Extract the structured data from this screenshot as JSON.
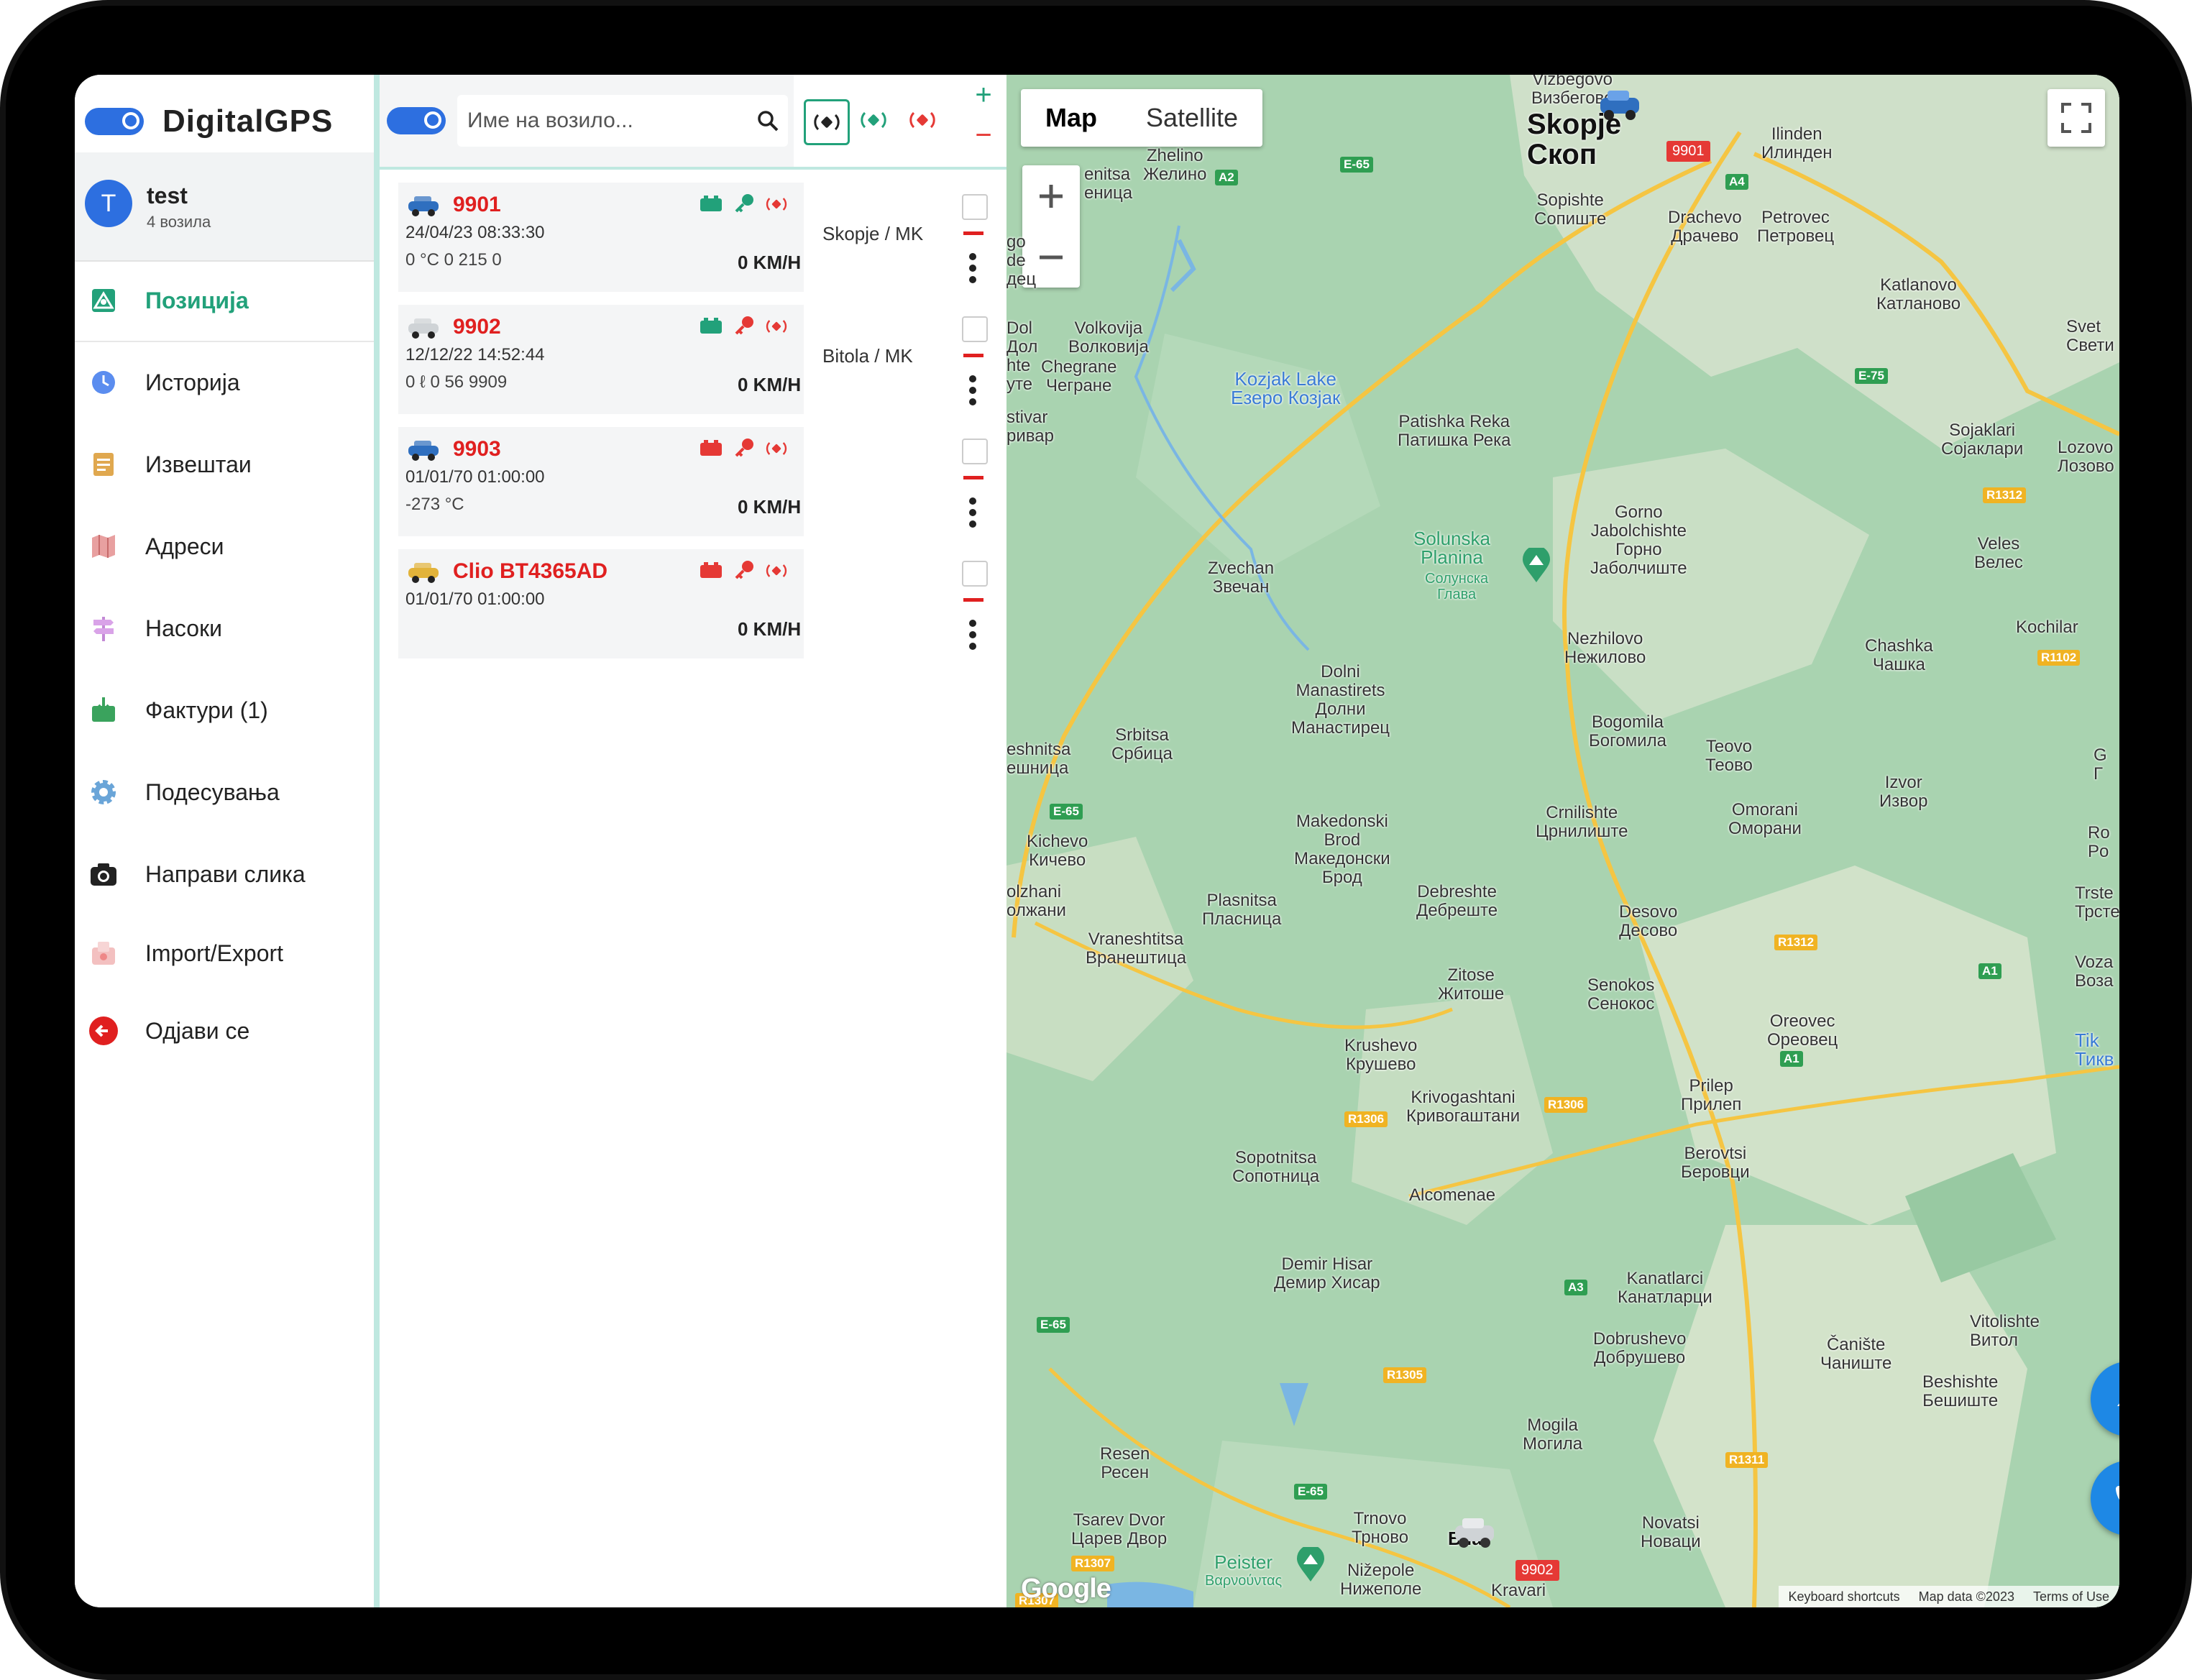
{
  "app": {
    "brand": "DigitalGPS"
  },
  "account": {
    "initial": "T",
    "name": "test",
    "subtitle": "4 возила"
  },
  "nav": [
    {
      "label": "Позиција",
      "icon": "map-position-icon",
      "active": true
    },
    {
      "label": "Историја",
      "icon": "history-clock-icon"
    },
    {
      "label": "Извештаи",
      "icon": "reports-icon"
    },
    {
      "label": "Адреси",
      "icon": "folded-map-icon"
    },
    {
      "label": "Насоки",
      "icon": "signpost-icon"
    },
    {
      "label": "Фактури (1)",
      "icon": "invoice-icon"
    },
    {
      "label": "Подесувања",
      "icon": "gear-icon"
    },
    {
      "label": "Направи слика",
      "icon": "camera-icon"
    },
    {
      "label": "Import/Export",
      "icon": "import-export-icon"
    },
    {
      "label": "Одјави се",
      "icon": "logout-icon"
    }
  ],
  "search": {
    "placeholder": "Име на возило..."
  },
  "vehicles": [
    {
      "name": "9901",
      "date": "24/04/23 08:33:30",
      "meta": "0 °C  0  215  0",
      "speed": "0 KM/H",
      "city": "Skopje / MK",
      "battery": "#22a17a",
      "key": "#22a17a",
      "signal": "#e53935"
    },
    {
      "name": "9902",
      "date": "12/12/22 14:52:44",
      "meta": "0 ℓ  0  56  9909",
      "speed": "0 KM/H",
      "city": "Bitola / MK",
      "battery": "#22a17a",
      "key": "#e53935",
      "signal": "#e53935"
    },
    {
      "name": "9903",
      "date": "01/01/70 01:00:00",
      "meta": "-273 °C",
      "speed": "0 KM/H",
      "city": "",
      "battery": "#e53935",
      "key": "#e53935",
      "signal": "#e53935"
    },
    {
      "name": "Clio BT4365AD",
      "date": "01/01/70 01:00:00",
      "meta": "",
      "speed": "0 KM/H",
      "city": "",
      "battery": "#e53935",
      "key": "#e53935",
      "signal": "#e53935"
    }
  ],
  "map": {
    "tab_map": "Map",
    "tab_satellite": "Satellite",
    "places": {
      "skopje": "Skopje",
      "skopje_cyr": "Скоп",
      "vizbegovo": "Vizbegovo",
      "vizbegovo_cyr": "Визбегово",
      "ilinden": "Ilinden",
      "ilinden_cyr": "Илинден",
      "zhelino": "Zhelino",
      "zhelino_cyr": "Желино",
      "sopishte": "Sopishte",
      "sopishte_cyr": "Сопиште",
      "drachevo": "Drachevo",
      "drachevo_cyr": "Драчево",
      "petrovec": "Petrovec",
      "petrovec_cyr": "Петровец",
      "katlanovo": "Katlanovo",
      "katlanovo_cyr": "Катланово",
      "volkovija": "Volkovija",
      "volkovija_cyr": "Волковија",
      "chegrane": "Chegrane",
      "chegrane_cyr": "Чегране",
      "kozjak": "Kozjak Lake",
      "kozjak_cyr": "Езеро Козјак",
      "patishka": "Patishka Reka",
      "patishka_cyr": "Патишка Река",
      "sojaklari": "Sojaklari",
      "sojaklari_cyr": "Сојаклари",
      "gorno": "Gorno",
      "jabolchishte": "Jabolchishte",
      "gorno_cyr": "Горно",
      "jabolchishte_cyr": "Јаболчиште",
      "solunska1": "Solunska",
      "solunska2": "Planina",
      "solunska_cyr1": "Солунска",
      "solunska_cyr2": "Глава",
      "veles": "Veles",
      "veles_cyr": "Велес",
      "zvechan": "Zvechan",
      "zvechan_cyr": "Звечан",
      "nezhilovo": "Nezhilovo",
      "nezhilovo_cyr": "Нежилово",
      "chashka": "Chashka",
      "chashka_cyr": "Чашка",
      "kochilar": "Kochilar",
      "dolni1": "Dolni",
      "dolni2": "Manastirets",
      "dolni_cyr1": "Долни",
      "dolni_cyr2": "Манастирец",
      "bogomila": "Bogomila",
      "bogomila_cyr": "Богомила",
      "teovo": "Teovo",
      "teovo_cyr": "Теово",
      "srbitsa": "Srbitsa",
      "srbitsa_cyr": "Србица",
      "izvor": "Izvor",
      "izvor_cyr": "Извор",
      "crnilishte": "Crnilishte",
      "crnilishte_cyr": "Црнилиште",
      "omorani": "Omorani",
      "omorani_cyr": "Оморани",
      "kichevo": "Kichevo",
      "kichevo_cyr": "Кичево",
      "makedonski1": "Makedonski",
      "makedonski2": "Brod",
      "makedonski_cyr1": "Македонски",
      "makedonski_cyr2": "Брод",
      "plasnitsa": "Plasnitsa",
      "plasnitsa_cyr": "Пласница",
      "debreshte": "Debreshte",
      "debreshte_cyr": "Дебреште",
      "desovo": "Desovo",
      "desovo_cyr": "Десово",
      "vraneshtitsa": "Vraneshtitsa",
      "vraneshtitsa_cyr": "Вранештица",
      "zitose": "Zitose",
      "zitose_cyr": "Житоше",
      "senokos": "Senokos",
      "senokos_cyr": "Сенокос",
      "oreovec": "Oreovec",
      "oreovec_cyr": "Ореовец",
      "krushevo": "Krushevo",
      "krushevo_cyr": "Крушево",
      "prilep": "Prilep",
      "prilep_cyr": "Прилеп",
      "krivogashtani": "Krivogashtani",
      "krivogashtani_cyr": "Кривогаштани",
      "berovtsi": "Berovtsi",
      "berovtsi_cyr": "Беровци",
      "sopotnitsa": "Sopotnitsa",
      "sopotnitsa_cyr": "Сопотница",
      "alcomenae": "Alcomenae",
      "demir": "Demir Hisar",
      "demir_cyr": "Демир Хисар",
      "kanatlarci": "Kanatlarci",
      "kanatlarci_cyr": "Канатларци",
      "dobrushevo": "Dobrushevo",
      "dobrushevo_cyr": "Добрушево",
      "caniste": "Čanište",
      "caniste_cyr": "Чаниште",
      "vitolishte": "Vitolishte",
      "vitolishte_cyr": "Витол",
      "beshishte": "Beshishte",
      "beshishte_cyr": "Бешиште",
      "mogila": "Mogila",
      "mogila_cyr": "Могила",
      "resen": "Resen",
      "resen_cyr": "Ресен",
      "tsarev": "Tsarev Dvor",
      "tsarev_cyr": "Царев Двор",
      "trnovo": "Trnovo",
      "trnovo_cyr": "Трново",
      "bitola_frag": "B   la",
      "bitola_frag2": "a",
      "novatsi": "Novatsi",
      "novatsi_cyr": "Новаци",
      "peister": "Peister",
      "peister_gr": "Βαρνούντας",
      "nizepole": "Nižepole",
      "nizepole_cyr": "Нижеполе",
      "kravari": "Kravari",
      "svet": "Svet",
      "svet_cyr": "Свети",
      "lozovo": "Lozovo",
      "lozovo_cyr": "Лозово",
      "ro": "Ro",
      "po": "Po",
      "trste": "Trste",
      "trste_cyr": "Трсте",
      "voza": "Voza",
      "voza_cyr": "Воза",
      "tik": "Tik",
      "tik_cyr": "Тикв",
      "g": "G",
      "g_cyr": "Г",
      "eshnitsa": "eshnitsa",
      "eshnitsa_cyr": "ешница",
      "olzhani": "olzhani",
      "olzhani_cyr": "олжани",
      "stivar": "stivar",
      "stivar_cyr": "ривар",
      "enitsa": "enitsa",
      "enitsa_cyr": "еница",
      "go": "go",
      "de": "de",
      "dets": "дец",
      "dol": "Dol",
      "dol_cyr": "Дол",
      "hte": "hte",
      "ute": "уте"
    },
    "roads": {
      "a2": "A2",
      "e65": "E-65",
      "a4": "A4",
      "e75": "E-75",
      "r1312": "R1312",
      "r1102": "R1102",
      "r1306": "R1306",
      "r1306b": "R1306",
      "a1": "A1",
      "a1b": "A1",
      "a3": "A3",
      "r1305": "R1305",
      "r1311": "R1311",
      "r1307": "R1307",
      "e65b": "E-65",
      "e65c": "E-65",
      "e65d": "E-65",
      "r1312b": "R1312",
      "r1307b": "R1307"
    },
    "markers": {
      "m9901": "9901",
      "m9902": "9902"
    },
    "attribution": {
      "shortcuts": "Keyboard shortcuts",
      "data": "Map data ©2023",
      "terms": "Terms of Use"
    },
    "google": "Google",
    "colors": {
      "land": "#a9d3b0",
      "light": "#dfe8d4",
      "road": "#f5c542",
      "water": "#7ab6e3"
    }
  }
}
